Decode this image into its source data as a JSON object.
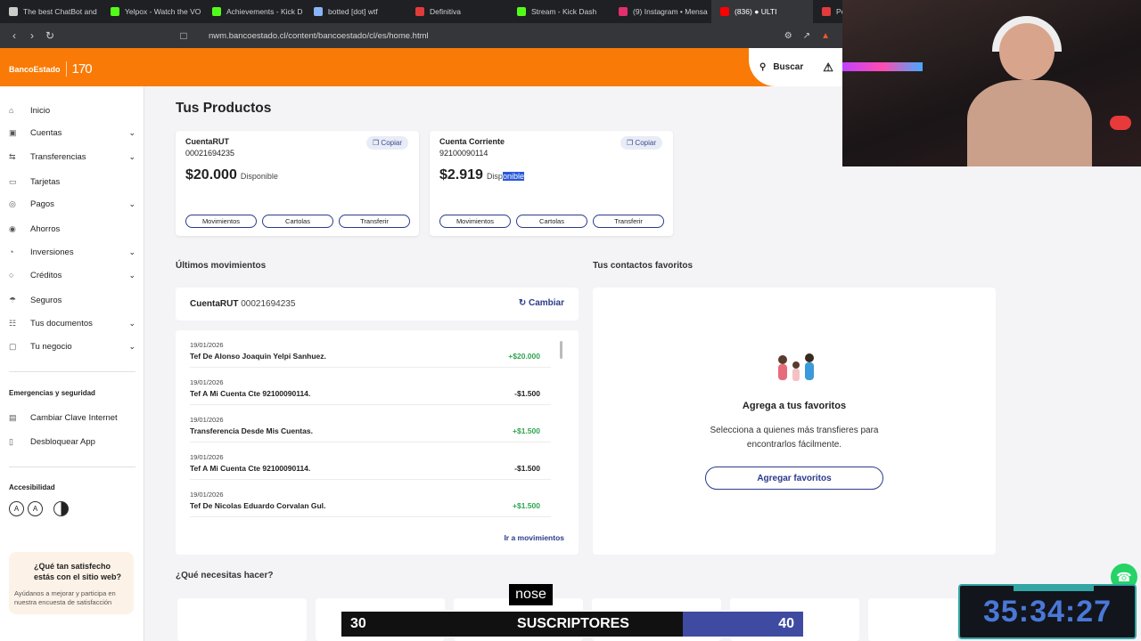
{
  "browser": {
    "tabs": [
      {
        "label": "The best ChatBot and",
        "icon": "chatbot-icon",
        "color": "#cccccc"
      },
      {
        "label": "Yelpox - Watch the VO",
        "icon": "kick-icon",
        "color": "#53fc18"
      },
      {
        "label": "Achievements - Kick D",
        "icon": "kick-icon",
        "color": "#53fc18"
      },
      {
        "label": "botted [dot] wtf",
        "icon": "globe-icon",
        "color": "#8ab4f8"
      },
      {
        "label": "Definitiva",
        "icon": "red-dot-icon",
        "color": "#e23b3b"
      },
      {
        "label": "Stream - Kick Dash",
        "icon": "kick-icon",
        "color": "#53fc18"
      },
      {
        "label": "(9) Instagram • Mensa",
        "icon": "instagram-icon",
        "color": "#e1306c"
      },
      {
        "label": "(836) ● ULTI",
        "icon": "youtube-icon",
        "color": "#ff0000",
        "active": true
      },
      {
        "label": "Po",
        "icon": "bank-icon",
        "color": "#e23b3b"
      }
    ],
    "url": "nwm.bancoestado.cl/content/bancoestado/cl/es/home.html"
  },
  "header": {
    "logo": "BancoEstado",
    "anniversary": "170",
    "search_label": "Buscar"
  },
  "sidebar": {
    "items": [
      {
        "label": "Inicio",
        "icon": "home-icon",
        "chev": false
      },
      {
        "label": "Cuentas",
        "icon": "wallet-icon",
        "chev": true
      },
      {
        "label": "Transferencias",
        "icon": "transfer-icon",
        "chev": true
      },
      {
        "label": "Tarjetas",
        "icon": "card-icon",
        "chev": false
      },
      {
        "label": "Pagos",
        "icon": "payments-icon",
        "chev": true
      },
      {
        "label": "Ahorros",
        "icon": "piggy-icon",
        "chev": false
      },
      {
        "label": "Inversiones",
        "icon": "investments-icon",
        "chev": true
      },
      {
        "label": "Créditos",
        "icon": "credit-icon",
        "chev": true
      },
      {
        "label": "Seguros",
        "icon": "insurance-icon",
        "chev": false
      },
      {
        "label": "Tus documentos",
        "icon": "documents-icon",
        "chev": true
      },
      {
        "label": "Tu negocio",
        "icon": "business-icon",
        "chev": true
      }
    ],
    "emergency_title": "Emergencias y seguridad",
    "emergency_items": [
      {
        "label": "Cambiar Clave Internet",
        "icon": "key-icon"
      },
      {
        "label": "Desbloquear App",
        "icon": "phone-icon"
      }
    ],
    "accessibility_title": "Accesibilidad",
    "acc_buttons": [
      "A",
      "A"
    ],
    "survey_title": "¿Qué tan satisfecho estás con el sitio web?",
    "survey_text": "Ayúdanos a mejorar y participa en nuestra encuesta de satisfacción"
  },
  "main": {
    "title": "Tus Productos",
    "copy_label": "Copiar",
    "available_label": "Disponible",
    "accounts": [
      {
        "name": "CuentaRUT",
        "number": "00021694235",
        "balance": "$20.000"
      },
      {
        "name": "Cuenta Corriente",
        "number": "92100090114",
        "balance": "$2.919"
      }
    ],
    "actions": [
      "Movimientos",
      "Cartolas",
      "Transferir"
    ],
    "movements_title": "Últimos movimientos",
    "movements_account": "CuentaRUT",
    "movements_account_num": "00021694235",
    "change_label": "Cambiar",
    "movements": [
      {
        "date": "19/01/2026",
        "desc": "Tef De Alonso Joaquin Yelpi Sanhuez.",
        "amount": "+$20.000",
        "positive": true
      },
      {
        "date": "19/01/2026",
        "desc": "Tef A Mi Cuenta Cte 92100090114.",
        "amount": "-$1.500",
        "positive": false
      },
      {
        "date": "19/01/2026",
        "desc": "Transferencia Desde Mis Cuentas.",
        "amount": "+$1.500",
        "positive": true
      },
      {
        "date": "19/01/2026",
        "desc": "Tef A Mi Cuenta Cte 92100090114.",
        "amount": "-$1.500",
        "positive": false
      },
      {
        "date": "19/01/2026",
        "desc": "Tef De Nicolas Eduardo Corvalan Gul.",
        "amount": "+$1.500",
        "positive": true
      }
    ],
    "go_movements": "Ir a movimientos",
    "favorites_title": "Tus contactos favoritos",
    "favorites_heading": "Agrega a tus favoritos",
    "favorites_text": "Selecciona a quienes más transfieres para encontrarlos fácilmente.",
    "favorites_button": "Agregar favoritos",
    "need_title": "¿Qué necesitas hacer?"
  },
  "overlay": {
    "caption": "nose",
    "sub_goal": {
      "from": "30",
      "label": "SUSCRIPTORES",
      "to": "40",
      "progress": 0.74
    },
    "timer": "35:34:27"
  },
  "colors": {
    "brand": "#f97a06",
    "accent": "#2b3a8c",
    "positive": "#2ea44f"
  }
}
